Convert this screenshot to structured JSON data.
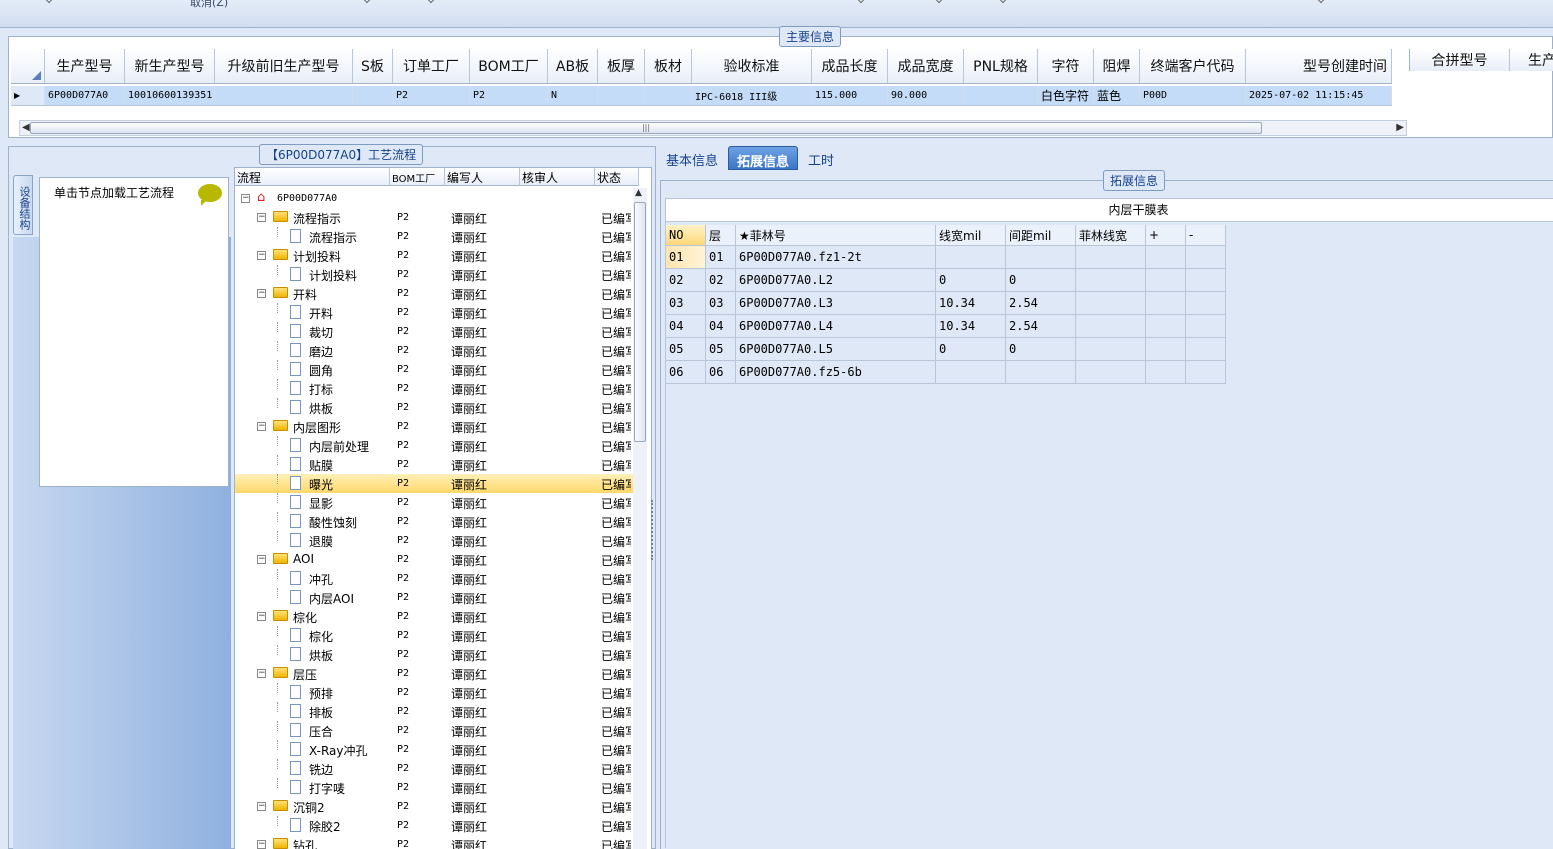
{
  "toolbar": {
    "cancel_label": "取消(Z)"
  },
  "main_info": {
    "title": "主要信息",
    "columns": [
      "生产型号",
      "新生产型号",
      "升级前旧生产型号",
      "S板",
      "订单工厂",
      "BOM工厂",
      "AB板",
      "板厚",
      "板材",
      "验收标准",
      "成品长度",
      "成品宽度",
      "PNL规格",
      "字符",
      "阻焊",
      "终端客户代码",
      "型号创建时间"
    ],
    "row": {
      "prod_model": "6P00D077A0",
      "new_model": "10010600139351",
      "old_model": "",
      "s_board": "",
      "order_factory": "P2",
      "bom_factory": "P2",
      "ab_board": "N",
      "thickness": "",
      "material": "",
      "standard": "IPC-6018 III级",
      "length": "115.000",
      "width": "90.000",
      "pnl": "",
      "char": "白色字符",
      "solder": "蓝色",
      "customer": "P00D",
      "created": "2025-07-02 11:15:45"
    },
    "extra_columns": [
      "合拼型号",
      "生产"
    ],
    "scroll_grip": "|||"
  },
  "process": {
    "title": "【6P00D077A0】工艺流程",
    "side_tab": "设备结构",
    "load_label": "单击节点加载工艺流程",
    "tree_headers": [
      "流程",
      "BOM工厂",
      "编写人",
      "核审人",
      "状态"
    ],
    "root": "6P00D077A0",
    "rows": [
      {
        "name": "流程指示",
        "bom": "P2",
        "writer": "谭丽红",
        "status": "已编写"
      },
      {
        "name": "流程指示",
        "bom": "P2",
        "writer": "谭丽红",
        "status": "已编写"
      },
      {
        "name": "计划投料",
        "bom": "P2",
        "writer": "谭丽红",
        "status": "已编写"
      },
      {
        "name": "计划投料",
        "bom": "P2",
        "writer": "谭丽红",
        "status": "已编写"
      },
      {
        "name": "开料",
        "bom": "P2",
        "writer": "谭丽红",
        "status": "已编写"
      },
      {
        "name": "开料",
        "bom": "P2",
        "writer": "谭丽红",
        "status": "已编写"
      },
      {
        "name": "裁切",
        "bom": "P2",
        "writer": "谭丽红",
        "status": "已编写"
      },
      {
        "name": "磨边",
        "bom": "P2",
        "writer": "谭丽红",
        "status": "已编写"
      },
      {
        "name": "圆角",
        "bom": "P2",
        "writer": "谭丽红",
        "status": "已编写"
      },
      {
        "name": "打标",
        "bom": "P2",
        "writer": "谭丽红",
        "status": "已编写"
      },
      {
        "name": "烘板",
        "bom": "P2",
        "writer": "谭丽红",
        "status": "已编写"
      },
      {
        "name": "内层图形",
        "bom": "P2",
        "writer": "谭丽红",
        "status": "已编写"
      },
      {
        "name": "内层前处理",
        "bom": "P2",
        "writer": "谭丽红",
        "status": "已编写"
      },
      {
        "name": "贴膜",
        "bom": "P2",
        "writer": "谭丽红",
        "status": "已编写"
      },
      {
        "name": "曝光",
        "bom": "P2",
        "writer": "谭丽红",
        "status": "已编写"
      },
      {
        "name": "显影",
        "bom": "P2",
        "writer": "谭丽红",
        "status": "已编写"
      },
      {
        "name": "酸性蚀刻",
        "bom": "P2",
        "writer": "谭丽红",
        "status": "已编写"
      },
      {
        "name": "退膜",
        "bom": "P2",
        "writer": "谭丽红",
        "status": "已编写"
      },
      {
        "name": "AOI",
        "bom": "P2",
        "writer": "谭丽红",
        "status": "已编写"
      },
      {
        "name": "冲孔",
        "bom": "P2",
        "writer": "谭丽红",
        "status": "已编写"
      },
      {
        "name": "内层AOI",
        "bom": "P2",
        "writer": "谭丽红",
        "status": "已编写"
      },
      {
        "name": "棕化",
        "bom": "P2",
        "writer": "谭丽红",
        "status": "已编写"
      },
      {
        "name": "棕化",
        "bom": "P2",
        "writer": "谭丽红",
        "status": "已编写"
      },
      {
        "name": "烘板",
        "bom": "P2",
        "writer": "谭丽红",
        "status": "已编写"
      },
      {
        "name": "层压",
        "bom": "P2",
        "writer": "谭丽红",
        "status": "已编写"
      },
      {
        "name": "预排",
        "bom": "P2",
        "writer": "谭丽红",
        "status": "已编写"
      },
      {
        "name": "排板",
        "bom": "P2",
        "writer": "谭丽红",
        "status": "已编写"
      },
      {
        "name": "压合",
        "bom": "P2",
        "writer": "谭丽红",
        "status": "已编写"
      },
      {
        "name": "X-Ray冲孔",
        "bom": "P2",
        "writer": "谭丽红",
        "status": "已编写"
      },
      {
        "name": "铣边",
        "bom": "P2",
        "writer": "谭丽红",
        "status": "已编写"
      },
      {
        "name": "打字唛",
        "bom": "P2",
        "writer": "谭丽红",
        "status": "已编写"
      },
      {
        "name": "沉铜2",
        "bom": "P2",
        "writer": "谭丽红",
        "status": "已编写"
      },
      {
        "name": "除胶2",
        "bom": "P2",
        "writer": "谭丽红",
        "status": "已编写"
      },
      {
        "name": "钻孔",
        "bom": "P2",
        "writer": "谭丽红",
        "status": "已编写"
      }
    ]
  },
  "tabs": [
    "基本信息",
    "拓展信息",
    "工时"
  ],
  "ext": {
    "title": "拓展信息",
    "table_title": "内层干膜表",
    "headers": [
      "NO",
      "层",
      "★菲林号",
      "线宽mil",
      "间距mil",
      "菲林线宽",
      "+",
      "-"
    ],
    "rows": [
      [
        "01",
        "01",
        "6P00D077A0.fz1-2t",
        "",
        "",
        "",
        "",
        ""
      ],
      [
        "02",
        "02",
        "6P00D077A0.L2",
        "0",
        "0",
        "",
        "",
        ""
      ],
      [
        "03",
        "03",
        "6P00D077A0.L3",
        "10.34",
        "2.54",
        "",
        "",
        ""
      ],
      [
        "04",
        "04",
        "6P00D077A0.L4",
        "10.34",
        "2.54",
        "",
        "",
        ""
      ],
      [
        "05",
        "05",
        "6P00D077A0.L5",
        "0",
        "0",
        "",
        "",
        ""
      ],
      [
        "06",
        "06",
        "6P00D077A0.fz5-6b",
        "",
        "",
        "",
        "",
        ""
      ]
    ]
  }
}
